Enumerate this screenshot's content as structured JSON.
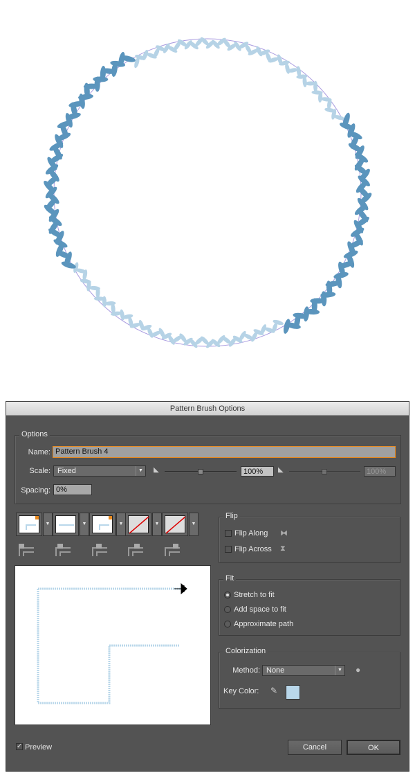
{
  "artwork": {
    "leaf_dark": "#5b95bd",
    "leaf_light": "#b6d3e6",
    "vine": "#a99be0"
  },
  "dialog": {
    "title": "Pattern Brush Options",
    "options": {
      "group_label": "Options",
      "name_label": "Name:",
      "name_value": "Pattern Brush 4",
      "scale_label": "Scale:",
      "scale_value": "Fixed",
      "scale_min": "100%",
      "scale_max": "100%",
      "spacing_label": "Spacing:",
      "spacing_value": "0%"
    },
    "tiles": [
      "Outer Corner Tile",
      "Side Tile",
      "Inner Corner Tile",
      "Start Tile",
      "End Tile"
    ],
    "flip": {
      "group_label": "Flip",
      "along": "Flip Along",
      "across": "Flip Across",
      "along_checked": false,
      "across_checked": false
    },
    "fit": {
      "group_label": "Fit",
      "options": [
        "Stretch to fit",
        "Add space to fit",
        "Approximate path"
      ],
      "selected": "Stretch to fit"
    },
    "colorization": {
      "group_label": "Colorization",
      "method_label": "Method:",
      "method_value": "None",
      "key_color_label": "Key Color:",
      "key_color": "#b9d7ea"
    },
    "preview_label": "Preview",
    "preview_checked": true,
    "cancel": "Cancel",
    "ok": "OK",
    "accent": "#e8891e"
  }
}
